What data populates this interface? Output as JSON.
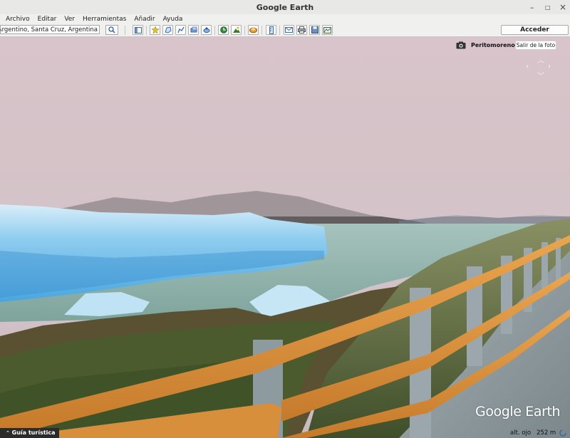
{
  "window": {
    "title": "Google Earth",
    "controls": {
      "minimize": "–",
      "maximize": "□",
      "close": "×"
    }
  },
  "menu": [
    "Archivo",
    "Editar",
    "Ver",
    "Herramientas",
    "Añadir",
    "Ayuda"
  ],
  "search": {
    "value": "Glaciar Perito Moreno, Parque Nacional Los Glaciares, El Calafate, Lago Argentino, Santa Cruz, Argentina"
  },
  "toolbar": {
    "login_label": "Acceder"
  },
  "photo": {
    "author": "Peritomoreno1",
    "exit_label": "Salir de la foto"
  },
  "footer": {
    "guide_label": "Guía turística",
    "brand": "Google Earth",
    "eye_alt_label": "alt. ojo",
    "eye_alt_value": "252 m"
  },
  "colors": {
    "railing": "#d98f3c",
    "ice": "#7fc3ea",
    "sky": "#d6c3c9",
    "lake": "#9dbeb5"
  },
  "icons": {
    "search": "search-icon",
    "sidebar": "sidebar-toggle-icon",
    "placemark": "add-placemark-icon",
    "polygon": "add-polygon-icon",
    "path": "add-path-icon",
    "overlay": "add-image-overlay-icon",
    "tour": "record-tour-icon",
    "history": "historical-imagery-icon",
    "sun": "sunlight-icon",
    "planets": "planets-icon",
    "ruler": "ruler-icon",
    "email": "email-icon",
    "print": "print-icon",
    "save_image": "save-image-icon",
    "maps": "view-in-maps-icon"
  }
}
